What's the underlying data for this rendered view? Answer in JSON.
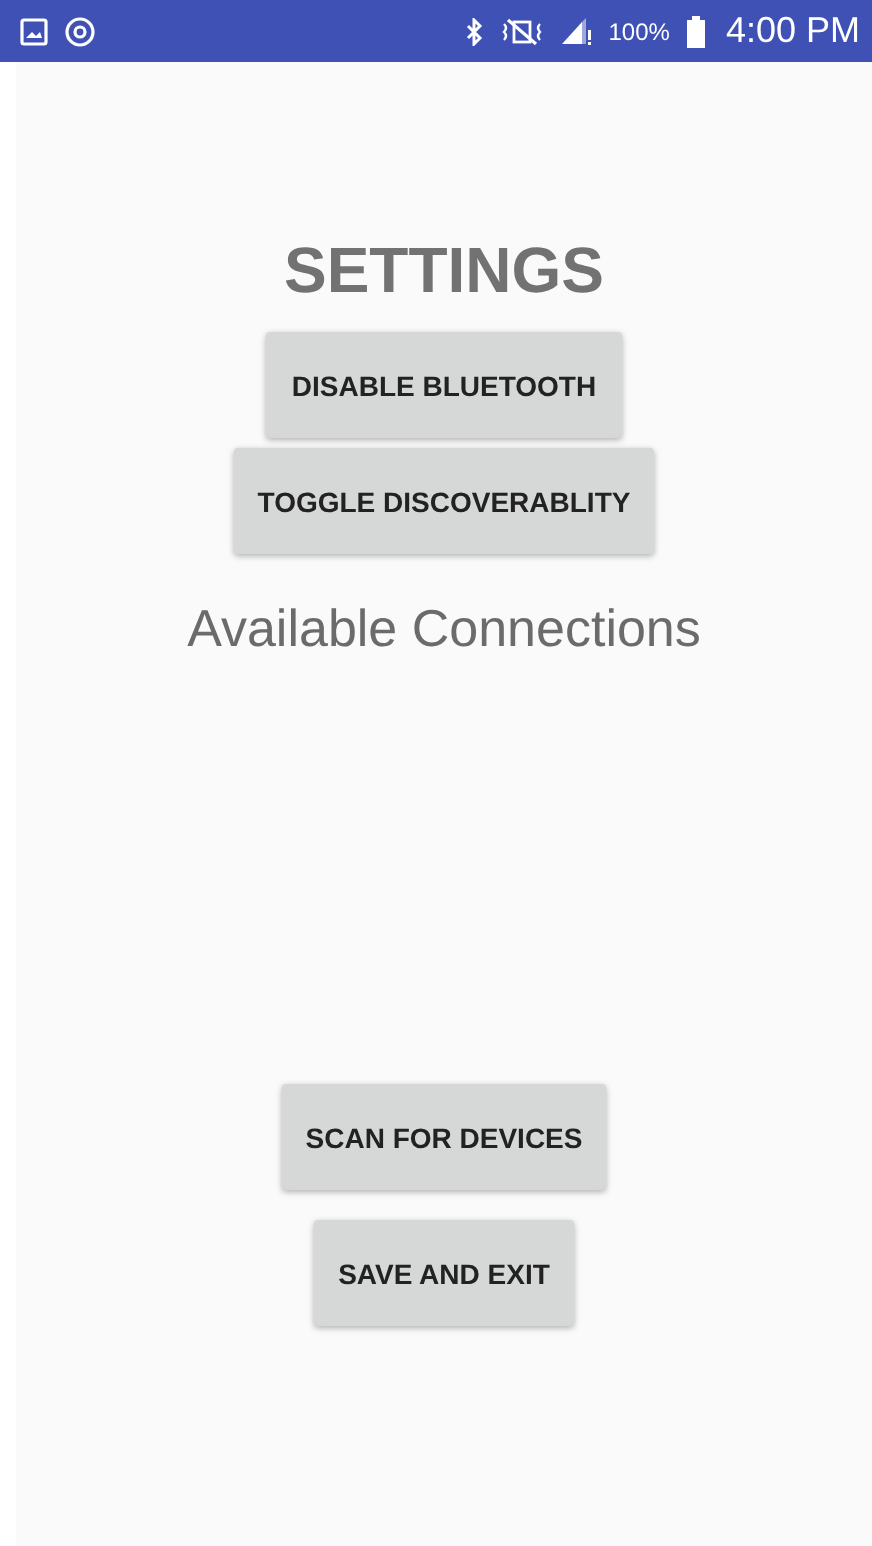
{
  "status_bar": {
    "battery_percent": "100%",
    "time": "4:00 PM"
  },
  "title": "SETTINGS",
  "top_buttons": [
    "DISABLE BLUETOOTH",
    "TOGGLE DISCOVERABLITY"
  ],
  "connections_heading": "Available Connections",
  "bottom_buttons": [
    "SCAN FOR DEVICES",
    "SAVE AND EXIT"
  ]
}
